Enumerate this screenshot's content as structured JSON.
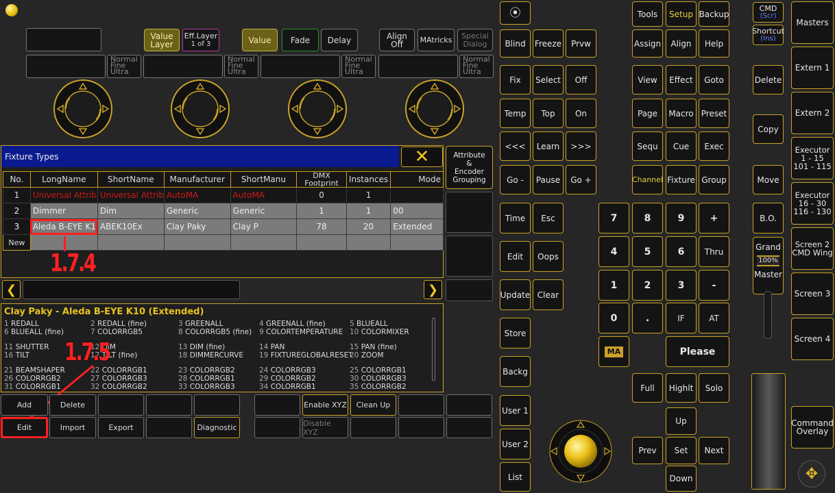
{
  "topbar": {
    "value_layer": "Value\nLayer",
    "eff_layer_title": "Eff.Layer",
    "eff_layer_sub": "1 of 3",
    "value": "Value",
    "fade": "Fade",
    "delay": "Delay",
    "align_off": "Align\nOff",
    "matricks": "MAtricks",
    "special_dialog": "Special\nDialog"
  },
  "resolution": {
    "normal": "Normal",
    "fine": "Fine",
    "ultra": "Ultra"
  },
  "fixture_types": {
    "title": "Fixture Types",
    "side_button": "Attribute\n&\nEncoder\nGrouping",
    "columns": [
      "No.",
      "LongName",
      "ShortName",
      "Manufacturer",
      "ShortManu",
      "DMX\nFootprint",
      "Instances",
      "Mode"
    ],
    "rows": [
      [
        "1",
        "Universal Attributes",
        "Universal Attributes",
        "AutoMA",
        "AutoMA",
        "0",
        "1",
        ""
      ],
      [
        "2",
        "Dimmer",
        "Dim",
        "Generic",
        "Generic",
        "1",
        "1",
        "00"
      ],
      [
        "3",
        "Aleda B-EYE K10",
        "ABEK10Ex",
        "Clay Paky",
        "Clay P",
        "78",
        "20",
        "Extended"
      ]
    ],
    "new_label": "New"
  },
  "annotations": {
    "a1": "1.7.4",
    "a2": "1.7.5"
  },
  "details": {
    "title": "Clay Paky - Aleda B-EYE K10 (Extended)",
    "attrs": [
      [
        "1",
        "REDALL"
      ],
      [
        "2",
        "REDALL (fine)"
      ],
      [
        "3",
        "GREENALL"
      ],
      [
        "4",
        "GREENALL (fine)"
      ],
      [
        "5",
        "BLUEALL"
      ],
      [
        "6",
        "BLUEALL (fine)"
      ],
      [
        "7",
        "COLORRGB5"
      ],
      [
        "8",
        "COLORRGB5 (fine)"
      ],
      [
        "9",
        "COLORTEMPERATURE"
      ],
      [
        "10",
        "COLORMIXER"
      ],
      [
        "11",
        "SHUTTER"
      ],
      [
        "12",
        "DIM"
      ],
      [
        "13",
        "DIM (fine)"
      ],
      [
        "14",
        "PAN"
      ],
      [
        "15",
        "PAN (fine)"
      ],
      [
        "16",
        "TILT"
      ],
      [
        "17",
        "TILT (fine)"
      ],
      [
        "18",
        "DIMMERCURVE"
      ],
      [
        "19",
        "FIXTUREGLOBALRESET"
      ],
      [
        "20",
        "ZOOM"
      ],
      [
        "21",
        "BEAMSHAPER"
      ],
      [
        "22",
        "COLORRGB1"
      ],
      [
        "23",
        "COLORRGB2"
      ],
      [
        "24",
        "COLORRGB3"
      ],
      [
        "25",
        "COLORRGB1"
      ],
      [
        "26",
        "COLORRGB2"
      ],
      [
        "27",
        "COLORRGB3"
      ],
      [
        "28",
        "COLORRGB1"
      ],
      [
        "29",
        "COLORRGB2"
      ],
      [
        "30",
        "COLORRGB3"
      ],
      [
        "31",
        "COLORRGB1"
      ],
      [
        "32",
        "COLORRGB2"
      ],
      [
        "33",
        "COLORRGB3"
      ],
      [
        "34",
        "COLORRGB1"
      ],
      [
        "35",
        "COLORRGB2"
      ]
    ]
  },
  "bottom_buttons": {
    "add": "Add",
    "delete": "Delete",
    "enable_xyz": "Enable XYZ",
    "clean_up": "Clean Up",
    "edit": "Edit",
    "import": "Import",
    "export": "Export",
    "diagnostic": "Diagnostic",
    "disable_xyz": "Disable XYZ"
  },
  "console": {
    "k_blind": "Blind",
    "k_freeze": "Freeze",
    "k_prvw": "Prvw",
    "k_tools": "Tools",
    "k_setup": "Setup",
    "k_backup": "Backup",
    "k_assign": "Assign",
    "k_align": "Align",
    "k_help": "Help",
    "k_fix": "Fix",
    "k_select": "Select",
    "k_off": "Off",
    "k_view": "View",
    "k_effect": "Effect",
    "k_goto": "Goto",
    "k_temp": "Temp",
    "k_top": "Top",
    "k_on": "On",
    "k_page": "Page",
    "k_macro": "Macro",
    "k_preset": "Preset",
    "k_prev_ch": "<<<",
    "k_learn": "Learn",
    "k_next_ch": ">>>",
    "k_sequ": "Sequ",
    "k_cue": "Cue",
    "k_exec": "Exec",
    "k_gominus": "Go -",
    "k_pause": "Pause",
    "k_goplus": "Go +",
    "k_channel": "Channel",
    "k_fixture": "Fixture",
    "k_group": "Group",
    "k_time": "Time",
    "k_esc": "Esc",
    "k_edit": "Edit",
    "k_oops": "Oops",
    "k_update": "Update",
    "k_clear": "Clear",
    "k_store": "Store",
    "k_backg": "Backg",
    "k_user1": "User 1",
    "k_user2": "User 2",
    "k_list": "List",
    "n7": "7",
    "n8": "8",
    "n9": "9",
    "plus": "+",
    "n4": "4",
    "n5": "5",
    "n6": "6",
    "thru": "Thru",
    "n1": "1",
    "n2": "2",
    "n3": "3",
    "minus": "-",
    "n0": "0",
    "dot": ".",
    "if": "IF",
    "at": "AT",
    "ma_logo": "MA",
    "please": "Please",
    "full": "Full",
    "highlt": "Highlt",
    "solo": "Solo",
    "up": "Up",
    "prev": "Prev",
    "set": "Set",
    "next": "Next",
    "down": "Down"
  },
  "right_panel": {
    "cmd": "CMD",
    "cmd_sub": "(Scr)",
    "shortcut": "Shortcut",
    "shortcut_sub": "(Ins)",
    "delete": "Delete",
    "copy": "Copy",
    "move": "Move",
    "bo": "B.O.",
    "grand": "Grand",
    "grand_pct": "100%",
    "master": "Master",
    "masters": "Masters",
    "extern1": "Extern 1",
    "extern2": "Extern 2",
    "executor1": "Executor\n1 - 15\n101 - 115",
    "executor2": "Executor\n16 - 30\n116 - 130",
    "screen2": "Screen 2\nCMD Wing",
    "screen3": "Screen 3",
    "screen4": "Screen 4",
    "command_overlay": "Command\nOverlay"
  },
  "colors": {
    "accent": "#caa227",
    "title_bar": "#0a1a8f",
    "highlight_red": "#ff2020",
    "row_gray": "#7b7b7b"
  }
}
